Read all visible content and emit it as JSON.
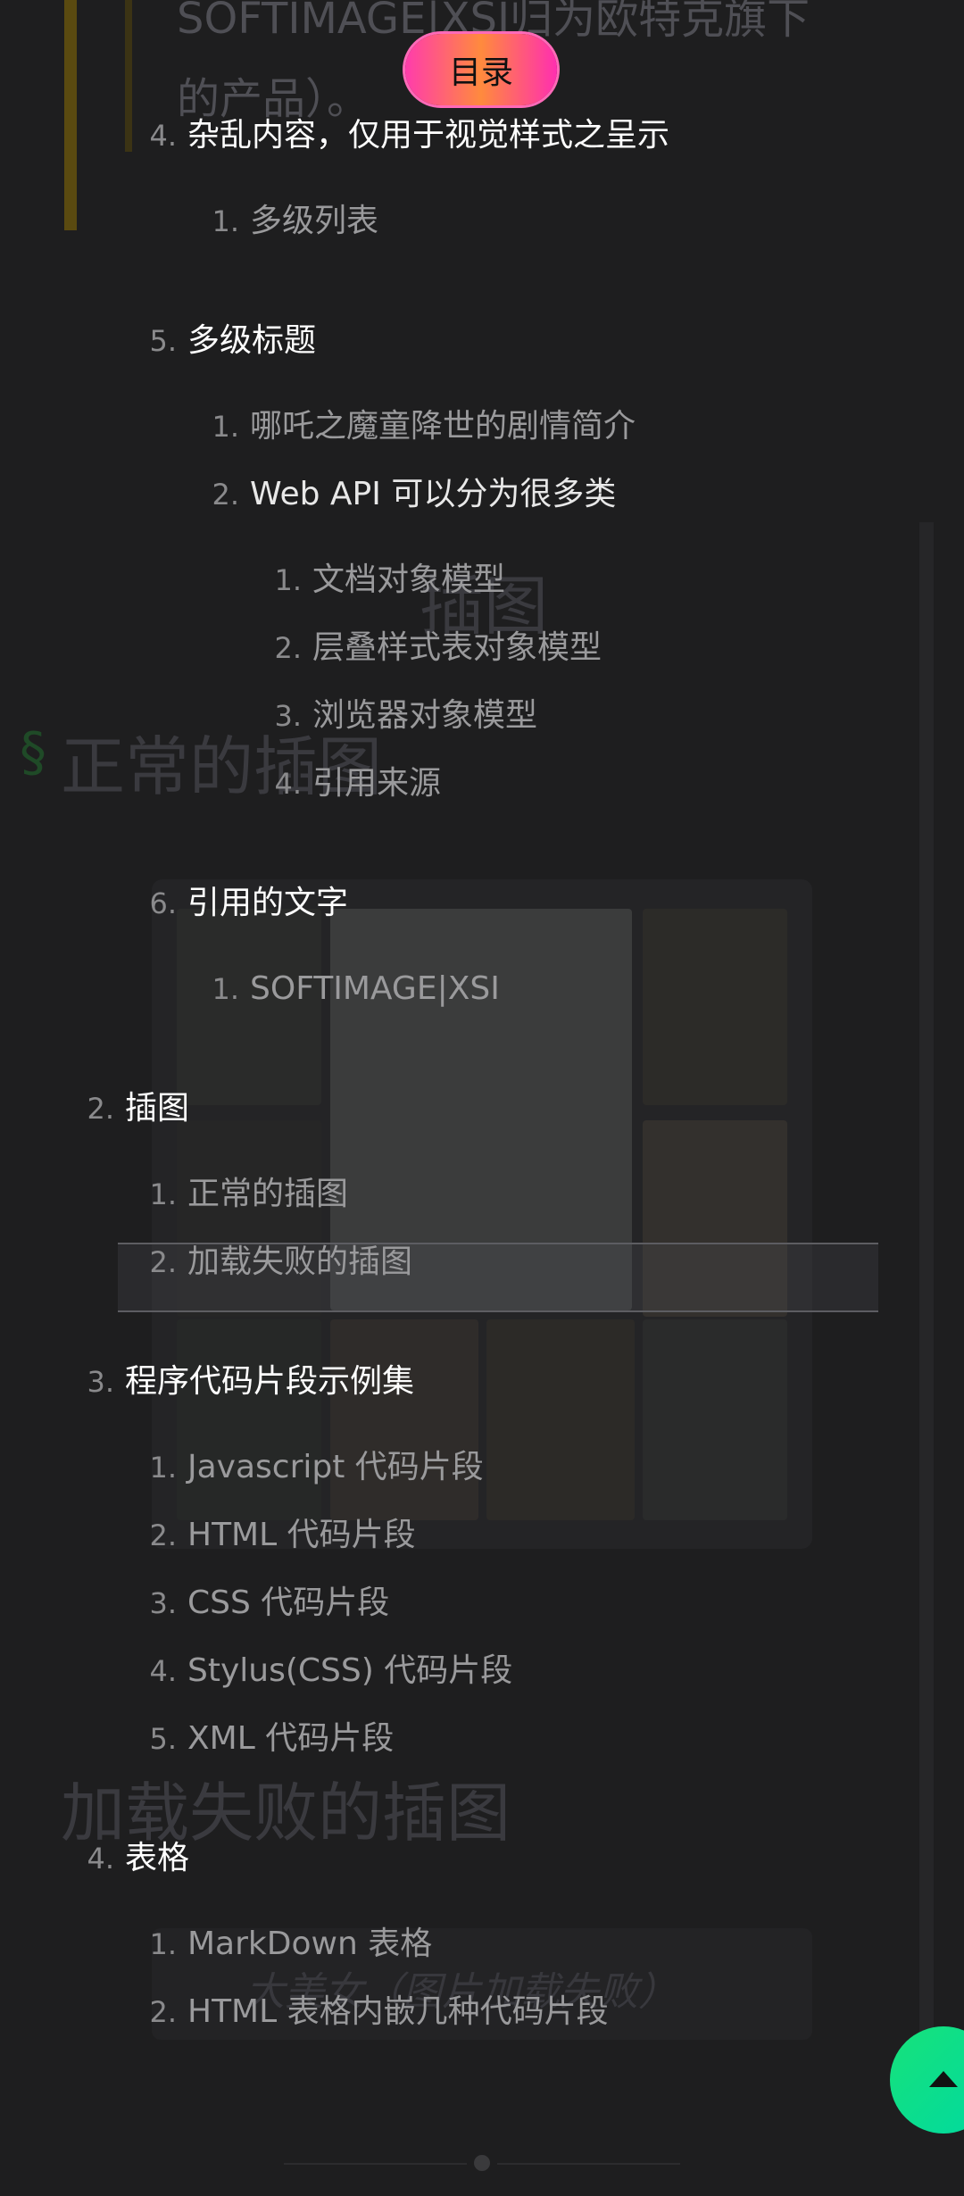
{
  "toc_button": {
    "label": "目录"
  },
  "background_article": {
    "top_paragraph": [
      "SOFTIMAGE|XSI归为欧特克旗下",
      "的产品）。"
    ],
    "headings": {
      "illustration": "插图",
      "normal_illustration": "正常的插图",
      "failed_illustration": "加载失败的插图"
    },
    "section_mark": "§",
    "failed_image_caption": "大美女（图片加载失败）"
  },
  "toc": {
    "items": [
      {
        "num": "4.",
        "text": "杂乱内容，仅用于视觉样式之呈示",
        "level": 1
      },
      {
        "num": "1.",
        "text": "多级列表",
        "level": 2
      },
      {
        "num": "5.",
        "text": "多级标题",
        "level": 1
      },
      {
        "num": "1.",
        "text": "哪吒之魔童降世的剧情简介",
        "level": 2
      },
      {
        "num": "2.",
        "text": "Web API 可以分为很多类",
        "level": 2
      },
      {
        "num": "1.",
        "text": "文档对象模型",
        "level": 3
      },
      {
        "num": "2.",
        "text": "层叠样式表对象模型",
        "level": 3
      },
      {
        "num": "3.",
        "text": "浏览器对象模型",
        "level": 3
      },
      {
        "num": "4.",
        "text": "引用来源",
        "level": 3
      },
      {
        "num": "6.",
        "text": "引用的文字",
        "level": 1
      },
      {
        "num": "1.",
        "text": "SOFTIMAGE|XSI",
        "level": 2
      },
      {
        "num": "2.",
        "text": "插图",
        "level": 0
      },
      {
        "num": "1.",
        "text": "正常的插图",
        "level": 1
      },
      {
        "num": "2.",
        "text": "加载失败的插图",
        "level": 1,
        "active": true
      },
      {
        "num": "3.",
        "text": "程序代码片段示例集",
        "level": 0
      },
      {
        "num": "1.",
        "text": "Javascript 代码片段",
        "level": 1
      },
      {
        "num": "2.",
        "text": "HTML 代码片段",
        "level": 1
      },
      {
        "num": "3.",
        "text": "CSS 代码片段",
        "level": 1
      },
      {
        "num": "4.",
        "text": "Stylus(CSS) 代码片段",
        "level": 1
      },
      {
        "num": "5.",
        "text": "XML 代码片段",
        "level": 1
      },
      {
        "num": "4.",
        "text": "表格",
        "level": 0
      },
      {
        "num": "1.",
        "text": "MarkDown 表格",
        "level": 1
      },
      {
        "num": "2.",
        "text": "HTML 表格内嵌几种代码片段",
        "level": 1
      }
    ]
  },
  "back_to_top": {
    "icon": "arrow-up-icon"
  },
  "colors": {
    "background": "#1e1e1f",
    "toc_button_gradient": [
      "#ff3cac",
      "#ff8a3d"
    ],
    "back_to_top": "#17e27a",
    "text_primary": "#ffffff",
    "text_secondary": "#9a9a9c"
  }
}
